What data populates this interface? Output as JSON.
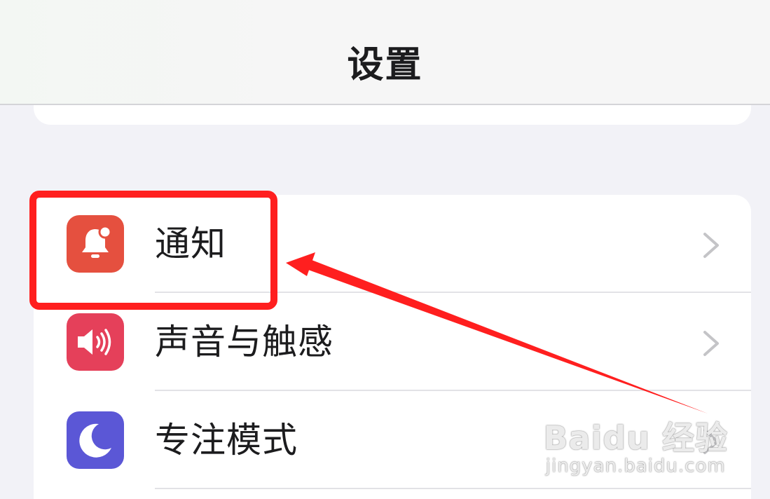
{
  "nav": {
    "title": "设置"
  },
  "settings_group": {
    "items": [
      {
        "label": "通知",
        "icon": "bell-icon",
        "icon_color": "#e5503f"
      },
      {
        "label": "声音与触感",
        "icon": "speaker-icon",
        "icon_color": "#e5405a"
      },
      {
        "label": "专注模式",
        "icon": "moon-icon",
        "icon_color": "#5b57d6"
      }
    ]
  },
  "annotation": {
    "highlight_color": "#ff1f1f",
    "arrow_color": "#ff1f1f"
  },
  "watermark": {
    "brand": "Baidu 经验",
    "url": "jingyan.baidu.com"
  }
}
